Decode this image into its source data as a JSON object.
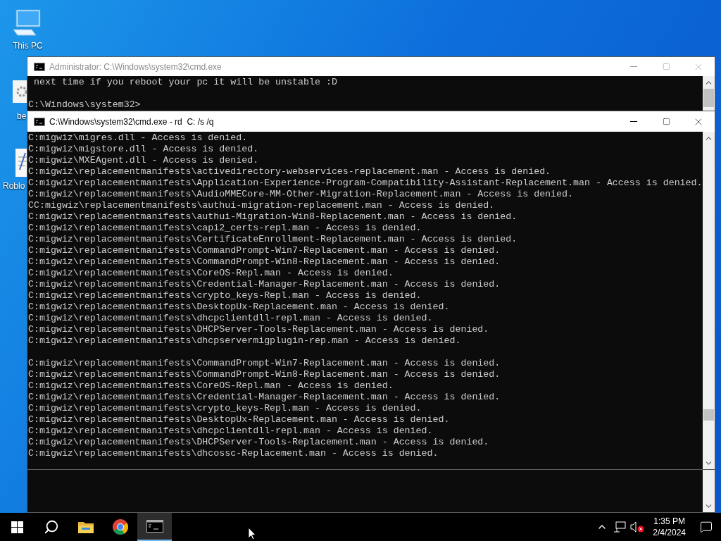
{
  "desktop_icons": [
    {
      "label": "This PC",
      "kind": "computer"
    },
    {
      "label": "be",
      "kind": "settings"
    },
    {
      "label": "Roblo",
      "kind": "document"
    }
  ],
  "windows": [
    {
      "title": "Administrator: C:\\Windows\\system32\\cmd.exe",
      "active": false,
      "console": [
        [
          " next time if you reboot your pc it will be unstable :D"
        ],
        [
          "C:\\Windows\\system32>"
        ]
      ]
    },
    {
      "title": "C:\\Windows\\system32\\cmd.exe - rd  C: /s /q",
      "active": true,
      "console": [
        [
          "C:migwiz\\migres.dll - Access is denied.",
          "C:migwiz\\migstore.dll - Access is denied.",
          "C:migwiz\\MXEAgent.dll - Access is denied.",
          "C:migwiz\\replacementmanifests\\activedirectory-webservices-replacement.man - Access is denied.",
          "C:migwiz\\replacementmanifests\\Application-Experience-Program-Compatibility-Assistant-Replacement.man - Access is denied.",
          "C:migwiz\\replacementmanifests\\AudioMMECore-MM-Other-Migration-Replacement.man - Access is denied.",
          "CC:migwiz\\replacementmanifests\\authui-migration-replacement.man - Access is denied.",
          "C:migwiz\\replacementmanifests\\authui-Migration-Win8-Replacement.man - Access is denied.",
          "C:migwiz\\replacementmanifests\\capi2_certs-repl.man - Access is denied.",
          "C:migwiz\\replacementmanifests\\CertificateEnrollment-Replacement.man - Access is denied.",
          "C:migwiz\\replacementmanifests\\CommandPrompt-Win7-Replacement.man - Access is denied.",
          "C:migwiz\\replacementmanifests\\CommandPrompt-Win8-Replacement.man - Access is denied.",
          "C:migwiz\\replacementmanifests\\CoreOS-Repl.man - Access is denied.",
          "C:migwiz\\replacementmanifests\\Credential-Manager-Replacement.man - Access is denied.",
          "C:migwiz\\replacementmanifests\\crypto_keys-Repl.man - Access is denied.",
          "C:migwiz\\replacementmanifests\\DesktopUx-Replacement.man - Access is denied.",
          "C:migwiz\\replacementmanifests\\dhcpclientdll-repl.man - Access is denied.",
          "C:migwiz\\replacementmanifests\\DHCPServer-Tools-Replacement.man - Access is denied.",
          "C:migwiz\\replacementmanifests\\dhcpservermigplugin-rep.man - Access is denied."
        ],
        [
          "C:migwiz\\replacementmanifests\\CommandPrompt-Win7-Replacement.man - Access is denied.",
          "C:migwiz\\replacementmanifests\\CommandPrompt-Win8-Replacement.man - Access is denied.",
          "C:migwiz\\replacementmanifests\\CoreOS-Repl.man - Access is denied.",
          "C:migwiz\\replacementmanifests\\Credential-Manager-Replacement.man - Access is denied.",
          "C:migwiz\\replacementmanifests\\crypto_keys-Repl.man - Access is denied.",
          "C:migwiz\\replacementmanifests\\DesktopUx-Replacement.man - Access is denied.",
          "C:migwiz\\replacementmanifests\\dhcpclientdll-repl.man - Access is denied.",
          "C:migwiz\\replacementmanifests\\DHCPServer-Tools-Replacement.man - Access is denied.",
          "C:migwiz\\replacementmanifests\\dhcossc-Replacement.man - Access is denied."
        ]
      ]
    }
  ],
  "taskbar": {
    "apps": [
      {
        "kind": "start",
        "active": false
      },
      {
        "kind": "search",
        "active": false
      },
      {
        "kind": "folder",
        "active": false
      },
      {
        "kind": "browser",
        "active": false
      },
      {
        "kind": "terminal",
        "active": true
      }
    ],
    "clock": {
      "time": "1:35 PM",
      "date": "2/4/2024"
    }
  }
}
